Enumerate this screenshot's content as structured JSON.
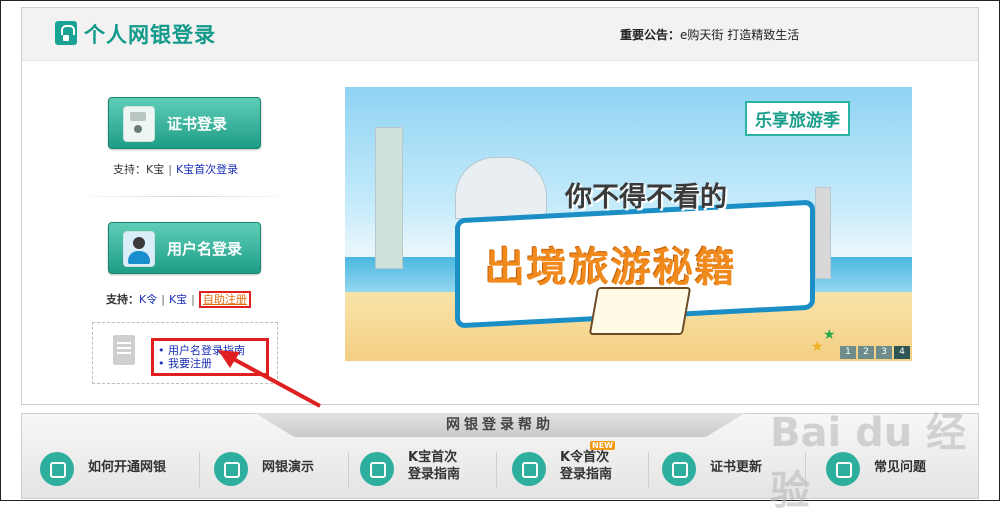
{
  "header": {
    "title": "个人网银登录",
    "notice_label": "重要公告：",
    "notice_text": "e购天街 打造精致生活"
  },
  "login": {
    "cert_button": "证书登录",
    "cert_support_label": "支持：",
    "cert_support_item1": "K宝",
    "cert_support_link": "K宝首次登录",
    "user_button": "用户名登录",
    "user_support_label": "支持：",
    "user_support_link1": "K令",
    "user_support_link2": "K宝",
    "user_support_link3": "自助注册",
    "guide_links": [
      "• 用户名登录指南",
      "• 我要注册"
    ]
  },
  "banner": {
    "tag": "乐享旅游季",
    "subtitle": "你不得不看的",
    "headline": "出境旅游秘籍",
    "pages": [
      "1",
      "2",
      "3",
      "4"
    ],
    "active_page": 4
  },
  "help": {
    "title": "网银登录帮助",
    "items": [
      {
        "line1": "如何开通网银",
        "line2": ""
      },
      {
        "line1": "网银演示",
        "line2": ""
      },
      {
        "line1": "K宝首次",
        "line2": "登录指南"
      },
      {
        "line1": "K令首次",
        "line2": "登录指南",
        "badge": "NEW"
      },
      {
        "line1": "证书更新",
        "line2": ""
      },
      {
        "line1": "常见问题",
        "line2": ""
      }
    ]
  },
  "watermark": "Bai du 经验",
  "colors": {
    "accent": "#1aa394",
    "highlight": "#e02020",
    "link": "#1b2fb6"
  }
}
